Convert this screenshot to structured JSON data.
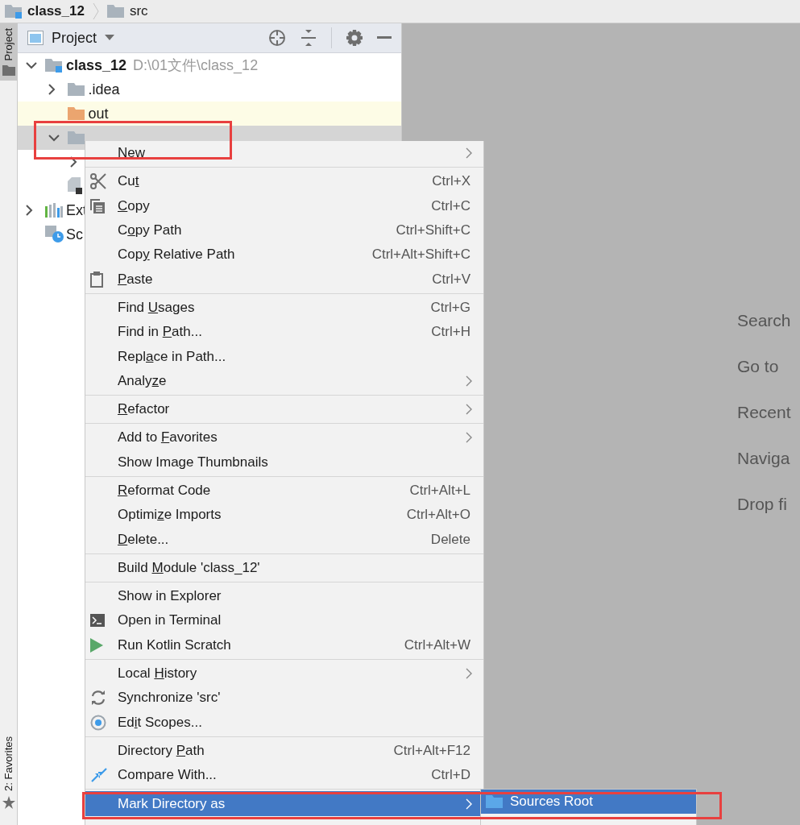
{
  "breadcrumbs": [
    {
      "label": "class_12",
      "kind": "module"
    },
    {
      "label": "src",
      "kind": "folder"
    }
  ],
  "tool_stripe": {
    "top": [
      {
        "label": "Project",
        "selected": true
      }
    ],
    "bottom": [
      {
        "label": "2: Favorites",
        "selected": false
      }
    ]
  },
  "project_panel": {
    "title": "Project"
  },
  "tree": [
    {
      "label": "class_12",
      "path": "D:\\01文件\\class_12",
      "kind": "module",
      "expanded": true,
      "selected": false,
      "children": [
        {
          "label": ".idea",
          "kind": "folder",
          "expanded": false,
          "selected": false
        },
        {
          "label": "out",
          "kind": "excluded-folder",
          "selected": false
        },
        {
          "kind": "folder",
          "expanded": true,
          "selected": true,
          "children": [
            {
              "expanded": false,
              "selected": false
            }
          ]
        },
        {
          "kind": "module-file",
          "selected": false
        }
      ]
    },
    {
      "label": "Ext",
      "kind": "libraries",
      "expanded": false,
      "selected": false
    },
    {
      "label": "Sc",
      "kind": "scratches",
      "selected": false
    }
  ],
  "welcome_hints": [
    "Search",
    "Go to",
    "Recent",
    "Naviga",
    "Drop fi"
  ],
  "context_menu": {
    "groups": [
      [
        {
          "label": "New",
          "submenu": true,
          "selected": false
        }
      ],
      [
        {
          "label": "Cut",
          "shortcut": "Ctrl+X",
          "submenu": false,
          "selected": false
        },
        {
          "label": "Copy",
          "shortcut": "Ctrl+C",
          "submenu": false,
          "selected": false
        },
        {
          "label": "Copy Path",
          "shortcut": "Ctrl+Shift+C",
          "submenu": false,
          "selected": false
        },
        {
          "label": "Copy Relative Path",
          "shortcut": "Ctrl+Alt+Shift+C",
          "submenu": false,
          "selected": false
        },
        {
          "label": "Paste",
          "shortcut": "Ctrl+V",
          "submenu": false,
          "selected": false
        }
      ],
      [
        {
          "label": "Find Usages",
          "shortcut": "Ctrl+G",
          "submenu": false,
          "selected": false
        },
        {
          "label": "Find in Path...",
          "shortcut": "Ctrl+H",
          "submenu": false,
          "selected": false
        },
        {
          "label": "Replace in Path...",
          "submenu": false,
          "selected": false
        },
        {
          "label": "Analyze",
          "submenu": true,
          "selected": false
        }
      ],
      [
        {
          "label": "Refactor",
          "submenu": true,
          "selected": false
        }
      ],
      [
        {
          "label": "Add to Favorites",
          "submenu": true,
          "selected": false
        },
        {
          "label": "Show Image Thumbnails",
          "submenu": false,
          "selected": false
        }
      ],
      [
        {
          "label": "Reformat Code",
          "shortcut": "Ctrl+Alt+L",
          "submenu": false,
          "selected": false
        },
        {
          "label": "Optimize Imports",
          "shortcut": "Ctrl+Alt+O",
          "submenu": false,
          "selected": false
        },
        {
          "label": "Delete...",
          "shortcut": "Delete",
          "submenu": false,
          "selected": false
        }
      ],
      [
        {
          "label": "Build Module 'class_12'",
          "submenu": false,
          "selected": false
        }
      ],
      [
        {
          "label": "Show in Explorer",
          "submenu": false,
          "selected": false
        },
        {
          "label": "Open in Terminal",
          "submenu": false,
          "selected": false
        },
        {
          "label": "Run Kotlin Scratch",
          "shortcut": "Ctrl+Alt+W",
          "submenu": false,
          "selected": false
        }
      ],
      [
        {
          "label": "Local History",
          "submenu": true,
          "selected": false
        },
        {
          "label": "Synchronize 'src'",
          "submenu": false,
          "selected": false
        },
        {
          "label": "Edit Scopes...",
          "submenu": false,
          "selected": false
        }
      ],
      [
        {
          "label": "Directory Path",
          "shortcut": "Ctrl+Alt+F12",
          "submenu": false,
          "selected": false
        },
        {
          "label": "Compare With...",
          "shortcut": "Ctrl+D",
          "submenu": false,
          "selected": false
        }
      ],
      [
        {
          "label": "Mark Directory as",
          "submenu": true,
          "selected": true
        }
      ]
    ]
  },
  "submenu": {
    "items": [
      {
        "label": "Sources Root",
        "kind": "sources",
        "selected": true
      }
    ]
  }
}
